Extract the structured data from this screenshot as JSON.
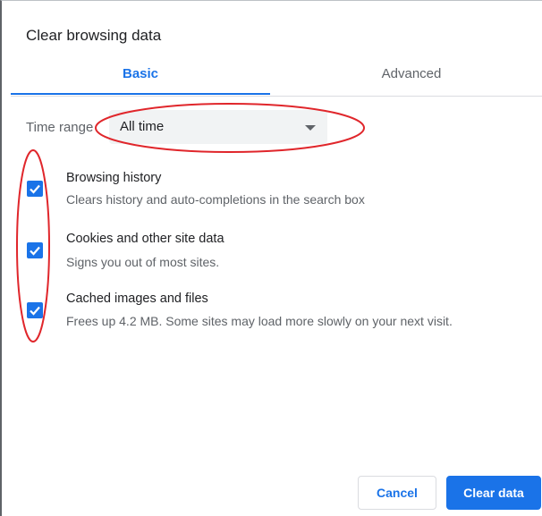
{
  "dialog": {
    "title": "Clear browsing data",
    "tabs": [
      {
        "label": "Basic",
        "active": true
      },
      {
        "label": "Advanced",
        "active": false
      }
    ],
    "time_range": {
      "label": "Time range",
      "value": "All time"
    },
    "options": [
      {
        "title": "Browsing history",
        "description": "Clears history and auto-completions in the search box",
        "checked": true
      },
      {
        "title": "Cookies and other site data",
        "description": "Signs you out of most sites.",
        "checked": true
      },
      {
        "title": "Cached images and files",
        "description": "Frees up 4.2 MB. Some sites may load more slowly on your next visit.",
        "checked": true
      }
    ],
    "buttons": {
      "cancel": "Cancel",
      "clear": "Clear data"
    }
  },
  "colors": {
    "accent": "#1a73e8",
    "annotation": "#e0262b"
  }
}
